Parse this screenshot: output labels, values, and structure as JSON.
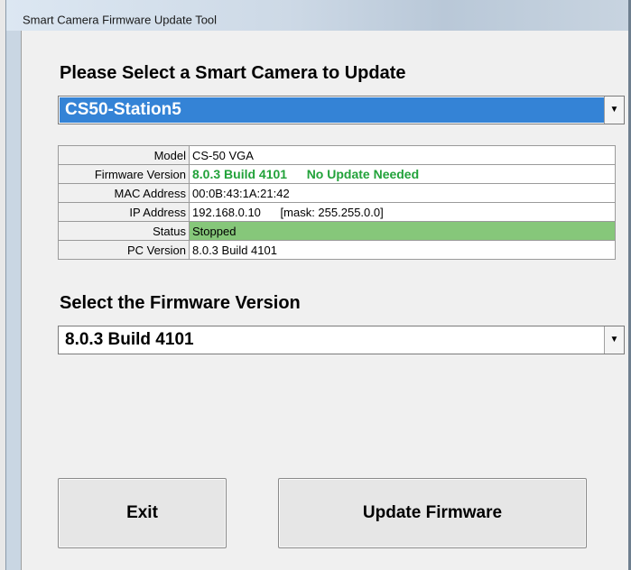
{
  "window": {
    "title": "Smart Camera Firmware Update Tool"
  },
  "camera_section": {
    "heading": "Please Select a Smart Camera to Update",
    "selected_camera": "CS50-Station5"
  },
  "info_table": {
    "model": {
      "label": "Model",
      "value": "CS-50 VGA"
    },
    "firmware": {
      "label": "Firmware Version",
      "value": "8.0.3 Build 4101",
      "note": "No Update Needed"
    },
    "mac": {
      "label": "MAC Address",
      "value": "00:0B:43:1A:21:42"
    },
    "ip": {
      "label": "IP Address",
      "value": "192.168.0.10",
      "mask": "[mask: 255.255.0.0]"
    },
    "status": {
      "label": "Status",
      "value": "Stopped"
    },
    "pc_version": {
      "label": "PC Version",
      "value": "8.0.3 Build 4101"
    }
  },
  "firmware_section": {
    "heading": "Select the Firmware Version",
    "selected_version": "8.0.3 Build 4101"
  },
  "buttons": {
    "exit": "Exit",
    "update": "Update Firmware"
  },
  "colors": {
    "selection_blue": "#3483d6",
    "ok_green_text": "#22a23a",
    "status_green": "#86c77a"
  },
  "icons": {
    "dropdown": "chevron-down-icon"
  }
}
